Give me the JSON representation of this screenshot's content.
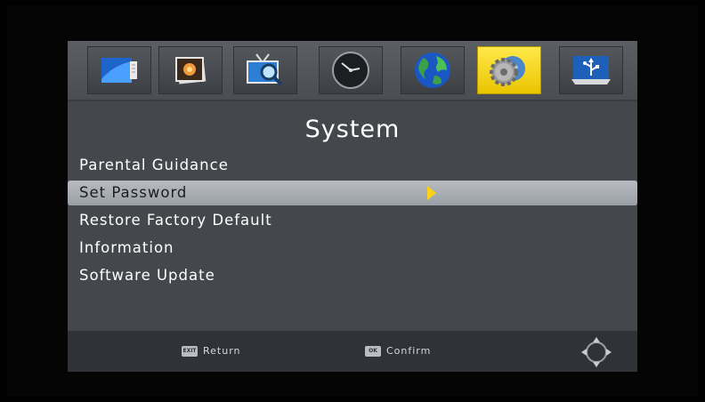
{
  "menu_tabs": [
    {
      "icon": "screen-picture-icon"
    },
    {
      "icon": "photo-media-icon"
    },
    {
      "icon": "tv-search-icon"
    },
    {
      "icon": "clock-icon"
    },
    {
      "icon": "globe-icon"
    },
    {
      "icon": "gear-settings-icon",
      "active": true
    },
    {
      "icon": "usb-icon"
    }
  ],
  "page": {
    "title": "System"
  },
  "menu": {
    "items": [
      {
        "label": "Parental Guidance"
      },
      {
        "label": "Set Password",
        "selected": true
      },
      {
        "label": "Restore Factory Default"
      },
      {
        "label": "Information"
      },
      {
        "label": "Software Update"
      }
    ]
  },
  "footer": {
    "exit_key": "EXIT",
    "exit_label": "Return",
    "ok_key": "OK",
    "ok_label": "Confirm"
  },
  "colors": {
    "background": "#44474b",
    "active_tab": "#ffe94a",
    "selection": "#aeb2b8",
    "arrow": "#ffd21a",
    "footer": "#2f3236"
  }
}
